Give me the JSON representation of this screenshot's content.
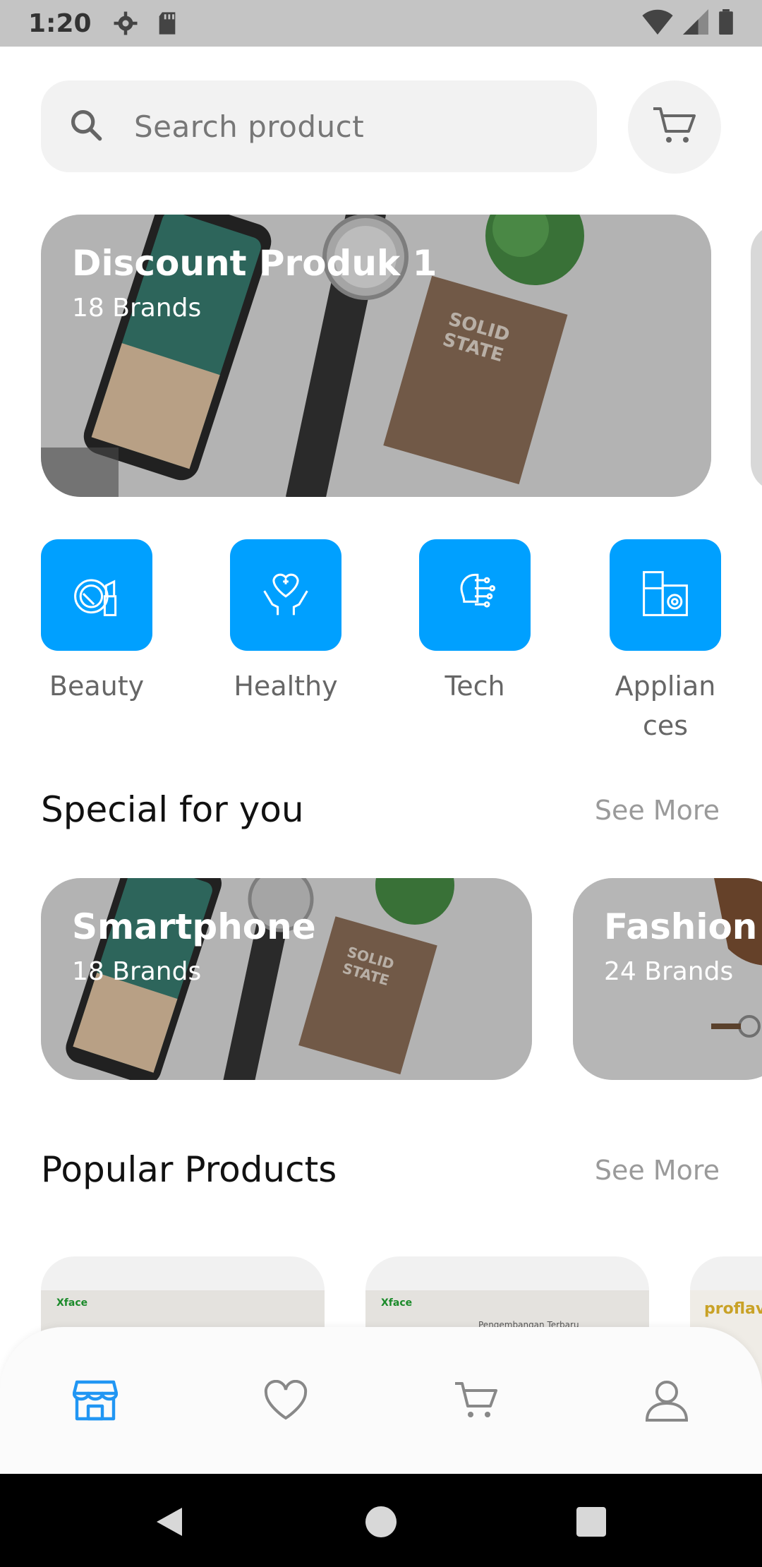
{
  "status_bar": {
    "time": "1:20"
  },
  "search": {
    "placeholder": "Search product"
  },
  "banner": {
    "title": "Discount Produk 1",
    "subtitle": "18 Brands"
  },
  "categories": [
    {
      "label": "Beauty",
      "icon": "beauty-icon"
    },
    {
      "label": "Healthy",
      "icon": "health-icon"
    },
    {
      "label": "Tech",
      "icon": "tech-icon"
    },
    {
      "label": "Applian ces",
      "icon": "appliances-icon"
    }
  ],
  "special": {
    "title": "Special for you",
    "see_more": "See More",
    "cards": [
      {
        "title": "Smartphone",
        "subtitle": "18 Brands"
      },
      {
        "title": "Fashion",
        "subtitle": "24 Brands"
      }
    ]
  },
  "popular": {
    "title": "Popular Products",
    "see_more": "See More",
    "products": [
      {
        "logo": "Xface",
        "text": ""
      },
      {
        "logo": "Xface",
        "text": "Pengembangan Terbaru"
      },
      {
        "logo": "proflava",
        "text": ""
      }
    ]
  },
  "bottom_nav": [
    "shop-icon",
    "heart-icon",
    "cart-icon",
    "user-icon"
  ],
  "colors": {
    "accent": "#00a0ff",
    "status_bar": "#c4c4c4"
  }
}
